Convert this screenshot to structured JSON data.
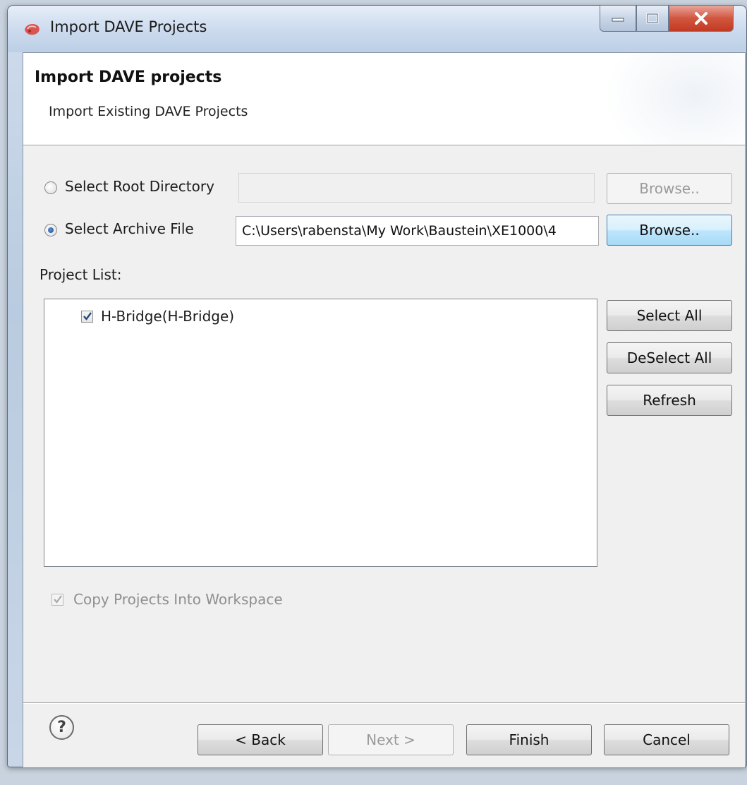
{
  "window": {
    "title": "Import DAVE Projects"
  },
  "banner": {
    "title": "Import DAVE projects",
    "subtitle": "Import Existing DAVE Projects"
  },
  "source": {
    "root_directory_label": "Select Root Directory",
    "root_directory_value": "",
    "root_directory_selected": false,
    "root_browse_label": "Browse..",
    "archive_file_label": "Select Archive File",
    "archive_file_value": "C:\\Users\\rabensta\\My Work\\Baustein\\XE1000\\4",
    "archive_file_selected": true,
    "archive_browse_label": "Browse.."
  },
  "project_list": {
    "label": "Project List:",
    "items": [
      {
        "label": "H-Bridge(H-Bridge)",
        "checked": true
      }
    ],
    "select_all_label": "Select All",
    "deselect_all_label": "DeSelect All",
    "refresh_label": "Refresh"
  },
  "options": {
    "copy_into_workspace_label": "Copy Projects Into Workspace",
    "copy_into_workspace_checked": true
  },
  "footer": {
    "back_label": "< Back",
    "next_label": "Next >",
    "finish_label": "Finish",
    "cancel_label": "Cancel",
    "help_icon": "help-icon"
  }
}
